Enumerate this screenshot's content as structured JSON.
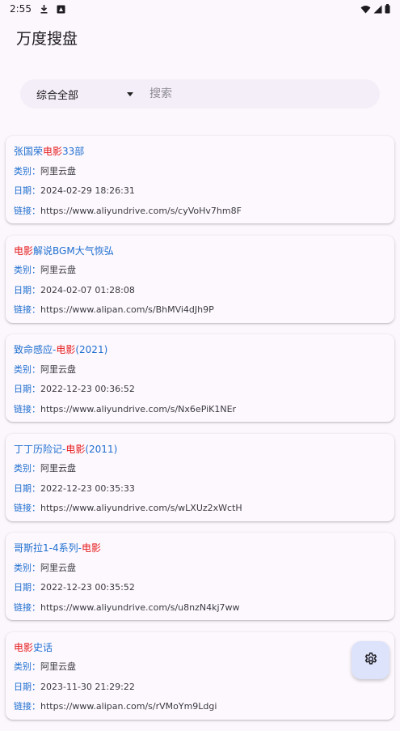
{
  "status_bar": {
    "time": "2:55"
  },
  "app": {
    "title": "万度搜盘"
  },
  "search": {
    "category": "综合全部",
    "placeholder": "搜索",
    "value": ""
  },
  "labels": {
    "category": "类别",
    "date": "日期",
    "link": "链接",
    "separator": "："
  },
  "results": [
    {
      "title_parts": [
        {
          "text": "张国荣",
          "highlight": false
        },
        {
          "text": "电影",
          "highlight": true
        },
        {
          "text": "33部",
          "highlight": false
        }
      ],
      "category": "阿里云盘",
      "date": "2024-02-29 18:26:31",
      "link": "https://www.aliyundrive.com/s/cyVoHv7hm8F"
    },
    {
      "title_parts": [
        {
          "text": "电影",
          "highlight": true
        },
        {
          "text": "解说BGM大气恢弘",
          "highlight": false
        }
      ],
      "category": "阿里云盘",
      "date": "2024-02-07 01:28:08",
      "link": "https://www.alipan.com/s/BhMVi4dJh9P"
    },
    {
      "title_parts": [
        {
          "text": "致命感应-",
          "highlight": false
        },
        {
          "text": "电影",
          "highlight": true
        },
        {
          "text": "(2021)",
          "highlight": false
        }
      ],
      "category": "阿里云盘",
      "date": "2022-12-23 00:36:52",
      "link": "https://www.aliyundrive.com/s/Nx6ePiK1NEr"
    },
    {
      "title_parts": [
        {
          "text": "丁丁历险记-",
          "highlight": false
        },
        {
          "text": "电影",
          "highlight": true
        },
        {
          "text": "(2011)",
          "highlight": false
        }
      ],
      "category": "阿里云盘",
      "date": "2022-12-23 00:35:33",
      "link": "https://www.aliyundrive.com/s/wLXUz2xWctH"
    },
    {
      "title_parts": [
        {
          "text": "哥斯拉1-4系列-",
          "highlight": false
        },
        {
          "text": "电影",
          "highlight": true
        }
      ],
      "category": "阿里云盘",
      "date": "2022-12-23 00:35:52",
      "link": "https://www.aliyundrive.com/s/u8nzN4kj7ww"
    },
    {
      "title_parts": [
        {
          "text": "电影",
          "highlight": true
        },
        {
          "text": "史话",
          "highlight": false
        }
      ],
      "category": "阿里云盘",
      "date": "2023-11-30 21:29:22",
      "link": "https://www.alipan.com/s/rVMoYm9Ldgi"
    }
  ],
  "icons": {
    "download": "download-icon",
    "notification": "notification-icon",
    "wifi": "wifi-icon",
    "signal": "signal-icon",
    "battery": "battery-icon",
    "dropdown": "dropdown-arrow-icon",
    "settings": "settings-icon"
  },
  "colors": {
    "background": "#fcf7fd",
    "accent_blue": "#1f6fcf",
    "highlight_red": "#e51c1c",
    "search_bg": "#f4eef8",
    "fab_bg": "#dde3fb"
  }
}
